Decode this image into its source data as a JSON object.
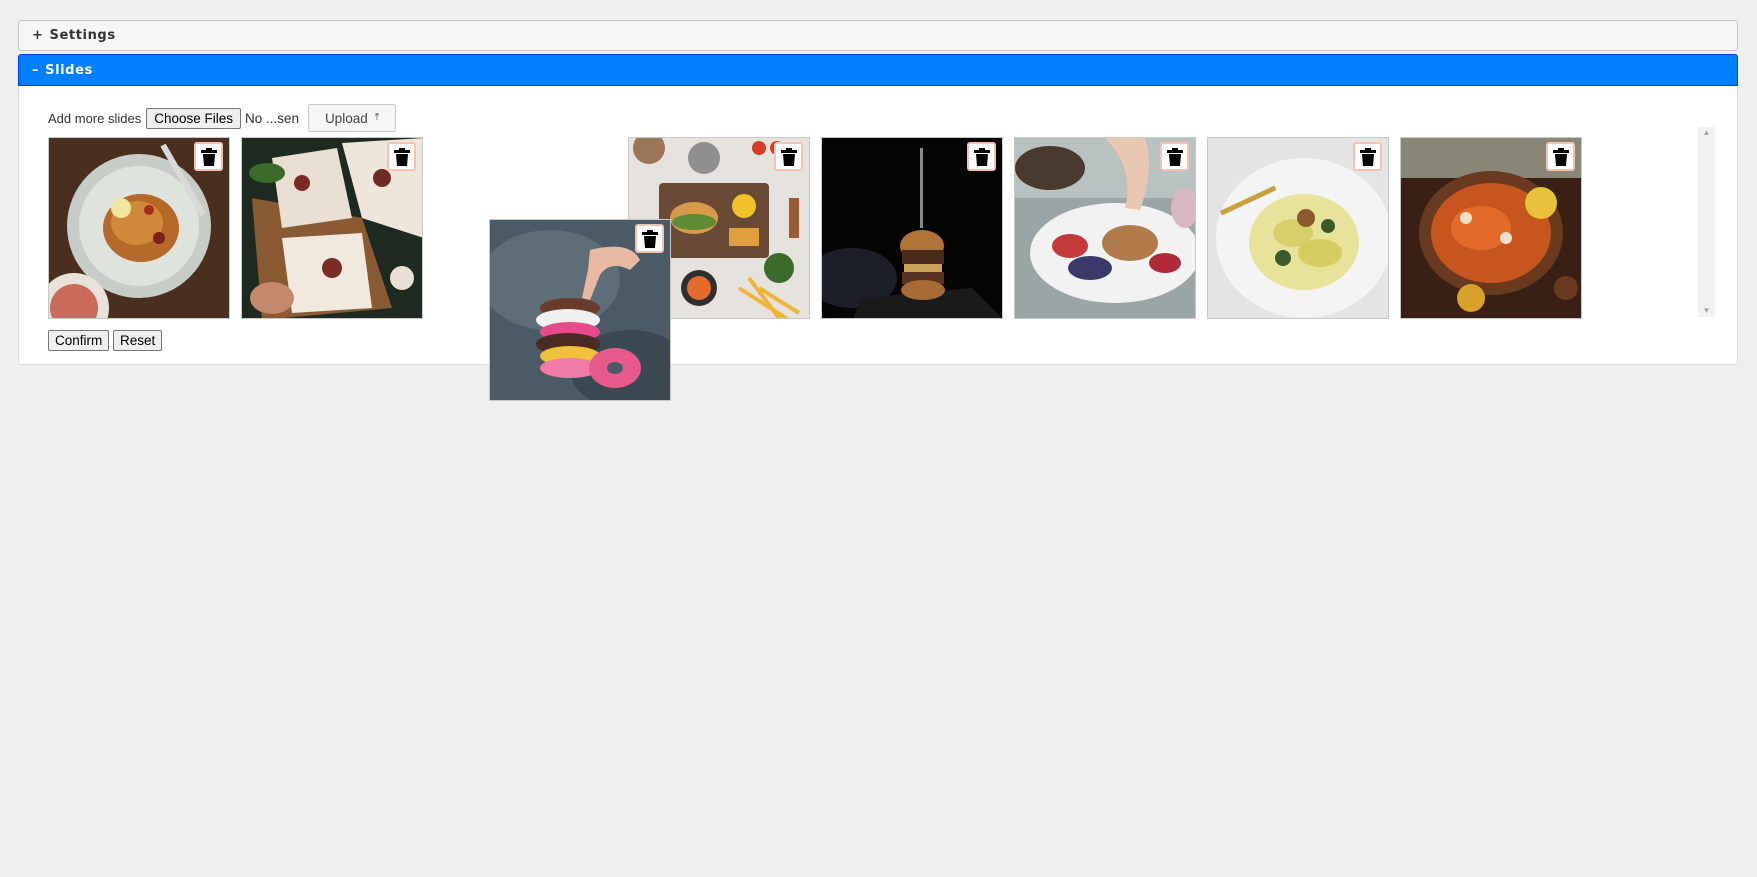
{
  "accordion": {
    "settings": {
      "toggle": "+",
      "label": "Settings"
    },
    "slides": {
      "toggle": "–",
      "label": "Slides"
    }
  },
  "upload": {
    "label": "Add more slides",
    "choose_files": "Choose Files",
    "no_file": "No ...sen",
    "upload_button": "Upload",
    "upload_icon": "⤒"
  },
  "slides": [
    {
      "icon": "spaghetti-plate-photo"
    },
    {
      "icon": "pizza-photo"
    },
    {
      "icon": "burger-platter-photo"
    },
    {
      "icon": "burger-dark-photo"
    },
    {
      "icon": "fruit-nuts-plate-photo"
    },
    {
      "icon": "gnocchi-bowl-photo"
    },
    {
      "icon": "curry-pan-photo"
    }
  ],
  "dragged_slide": {
    "icon": "donut-stack-photo"
  },
  "actions": {
    "confirm": "Confirm",
    "reset": "Reset"
  },
  "colors": {
    "accent": "#007fff",
    "accent_border": "#003eff",
    "trash_border": "#f2c2b4"
  }
}
